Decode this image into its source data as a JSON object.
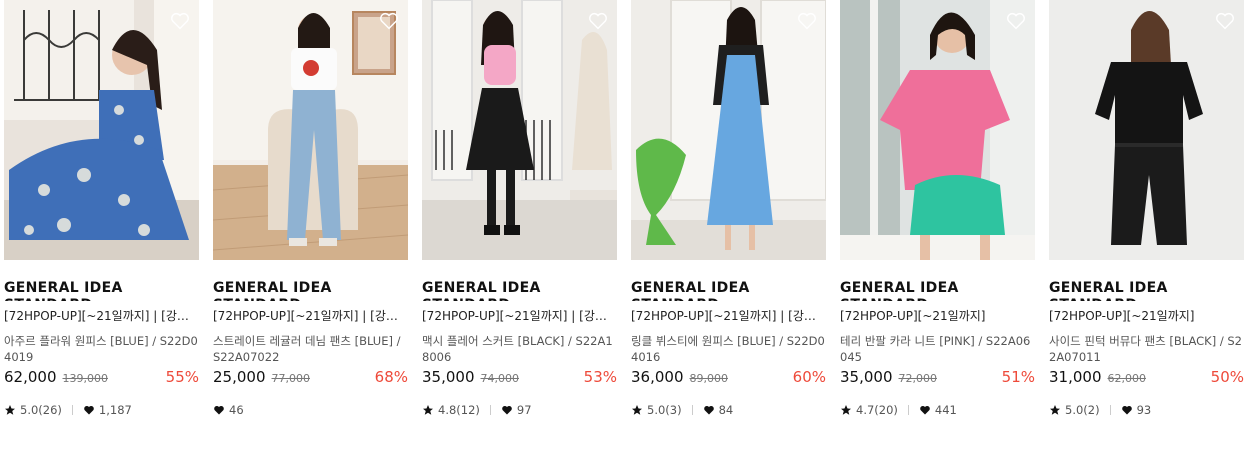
{
  "colors": {
    "discount": "#ee4a3a",
    "text": "#111111",
    "muted": "#777777"
  },
  "products": [
    {
      "brand": "GENERAL IDEA STANDARD",
      "promo": "[72HPOP-UP][~21일까지] | [강혜…",
      "name": "아주르 플라워 원피스 [BLUE] / S22D04019",
      "price": "62,000",
      "original_price": "139,000",
      "discount": "55%",
      "rating": "5.0(26)",
      "likes": "1,187"
    },
    {
      "brand": "GENERAL IDEA STANDARD",
      "promo": "[72HPOP-UP][~21일까지] | [강혜…",
      "name": "스트레이트 레귤러 데님 팬츠 [BLUE] / S22A07022",
      "price": "25,000",
      "original_price": "77,000",
      "discount": "68%",
      "rating": "",
      "likes": "46"
    },
    {
      "brand": "GENERAL IDEA STANDARD",
      "promo": "[72HPOP-UP][~21일까지] | [강혜…",
      "name": "맥시 플레어 스커트 [BLACK] / S22A18006",
      "price": "35,000",
      "original_price": "74,000",
      "discount": "53%",
      "rating": "4.8(12)",
      "likes": "97"
    },
    {
      "brand": "GENERAL IDEA STANDARD",
      "promo": "[72HPOP-UP][~21일까지] | [강혜…",
      "name": "링클 뷔스티에 원피스 [BLUE] / S22D04016",
      "price": "36,000",
      "original_price": "89,000",
      "discount": "60%",
      "rating": "5.0(3)",
      "likes": "84"
    },
    {
      "brand": "GENERAL IDEA STANDARD",
      "promo": "[72HPOP-UP][~21일까지]",
      "name": "테리 반팔 카라 니트 [PINK] / S22A06045",
      "price": "35,000",
      "original_price": "72,000",
      "discount": "51%",
      "rating": "4.7(20)",
      "likes": "441"
    },
    {
      "brand": "GENERAL IDEA STANDARD",
      "promo": "[72HPOP-UP][~21일까지]",
      "name": "사이드 핀턱 버뮤다 팬츠 [BLACK] / S22A07011",
      "price": "31,000",
      "original_price": "62,000",
      "discount": "50%",
      "rating": "5.0(2)",
      "likes": "93"
    }
  ]
}
